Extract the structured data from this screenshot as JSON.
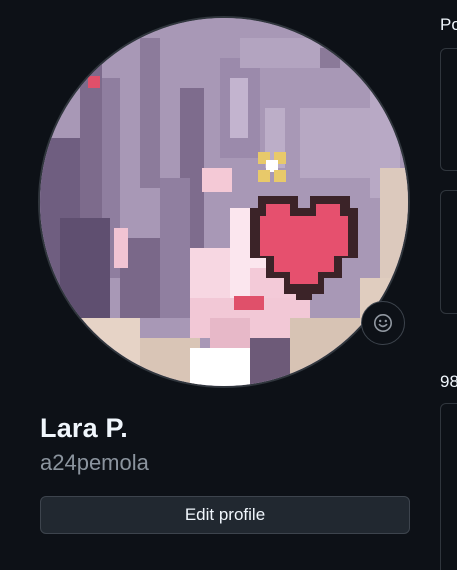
{
  "profile": {
    "full_name": "Lara P.",
    "username": "a24pemola",
    "edit_label": "Edit profile",
    "avatar_icon": "pixel-art-avatar",
    "status_icon": "smiley-icon"
  },
  "side": {
    "heading_1": "Po",
    "heading_2": "98"
  },
  "colors": {
    "background": "#0d1117",
    "name": "#f0f6fc",
    "username": "#8b949e",
    "button_bg": "#212830",
    "border": "#3d444d"
  }
}
